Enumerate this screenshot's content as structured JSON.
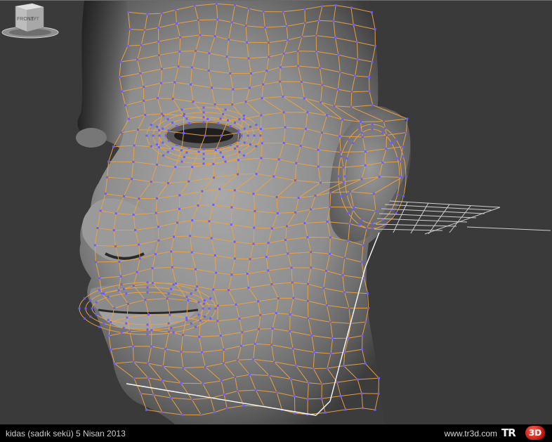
{
  "viewport": {
    "background": "#3a3a3a",
    "wire_color": "#f0a23c",
    "vertex_color": "#6a5cff",
    "skin_color": "#8a8a8a",
    "grid_color": "#cfcfcf",
    "viewcube": {
      "front_label": "FRONT",
      "side_label": "LEFT",
      "icon": "viewcube-icon"
    }
  },
  "footer": {
    "credit": "kidas (sadık sekü)  5 Nisan 2013",
    "site": "www.tr3d.com",
    "logo_text": "TR",
    "logo_badge": "3D"
  }
}
